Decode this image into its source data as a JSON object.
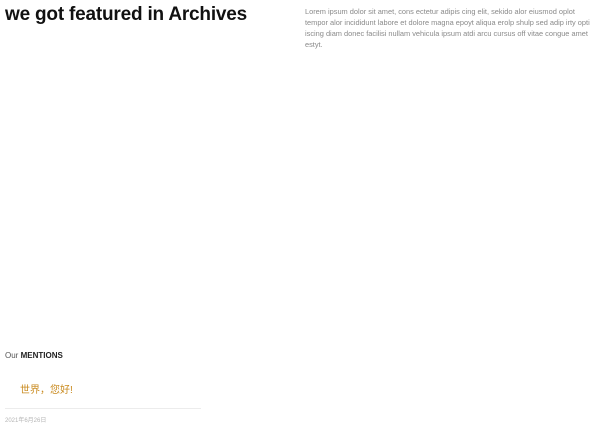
{
  "hero": {
    "title": "we got featured in Archives",
    "description": "Lorem ipsum dolor sit amet, cons ectetur adipis cing elit, sekido alor eiusmod oplot tempor alor incididunt labore et dolore magna epoyt aliqua erolp shulp sed adip irty opti iscing diam donec facilisi nullam vehicula ipsum atdi arcu cursus off vitae congue amet estyt."
  },
  "mentions": {
    "heading_prefix": "Our",
    "heading_strong": "MENTIONS",
    "items": [
      {
        "title": "世界，您好!",
        "date": "2021年6月26日"
      }
    ]
  },
  "colors": {
    "accent": "#c98a1e",
    "text_muted": "#8a8a8a",
    "divider": "#ececec"
  }
}
